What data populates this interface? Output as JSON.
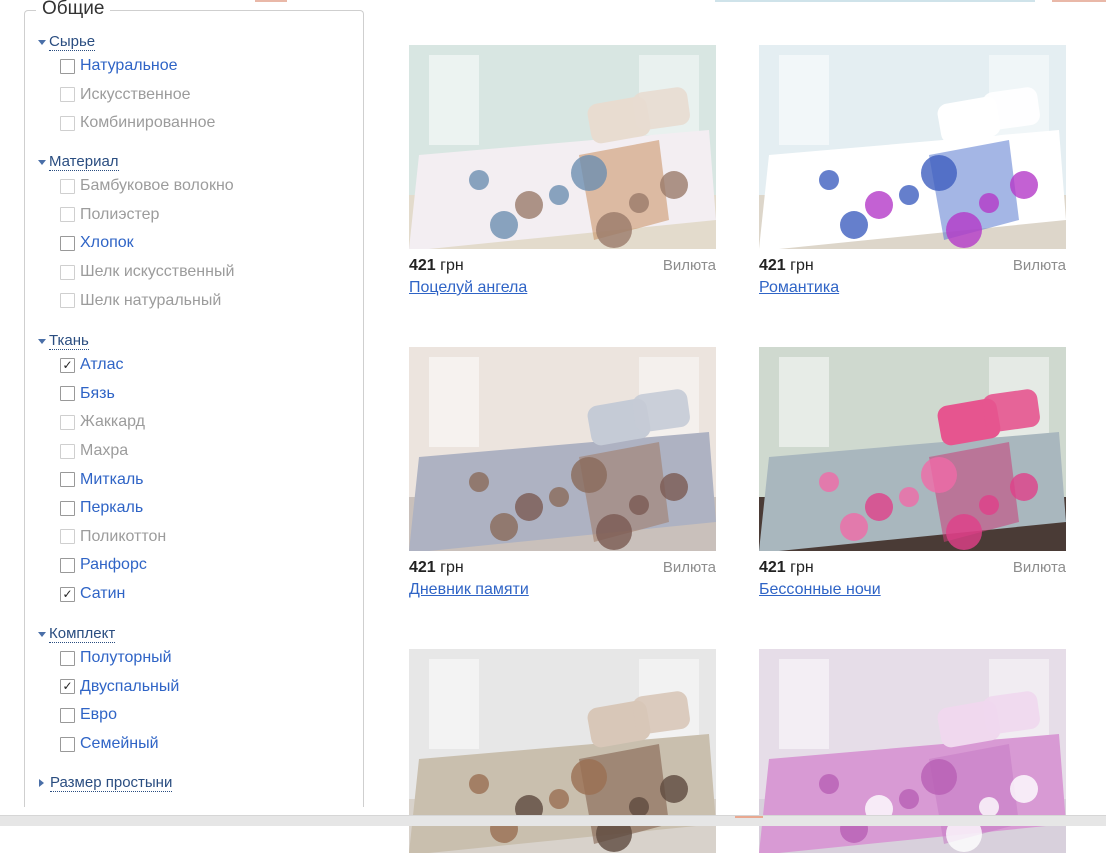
{
  "filters": {
    "title": "Общие",
    "groups": [
      {
        "label": "Сырье",
        "expanded": true,
        "options": [
          {
            "label": "Натуральное",
            "state": "active",
            "checked": false
          },
          {
            "label": "Искусственное",
            "state": "disabled",
            "checked": false
          },
          {
            "label": "Комбинированное",
            "state": "disabled",
            "checked": false
          }
        ]
      },
      {
        "label": "Материал",
        "expanded": true,
        "options": [
          {
            "label": "Бамбуковое волокно",
            "state": "disabled",
            "checked": false
          },
          {
            "label": "Полиэстер",
            "state": "disabled",
            "checked": false
          },
          {
            "label": "Хлопок",
            "state": "active",
            "checked": false
          },
          {
            "label": "Шелк искусственный",
            "state": "disabled",
            "checked": false
          },
          {
            "label": "Шелк натуральный",
            "state": "disabled",
            "checked": false
          }
        ]
      },
      {
        "label": "Ткань",
        "expanded": true,
        "options": [
          {
            "label": "Атлас",
            "state": "active",
            "checked": true
          },
          {
            "label": "Бязь",
            "state": "active",
            "checked": false
          },
          {
            "label": "Жаккард",
            "state": "disabled",
            "checked": false
          },
          {
            "label": "Махра",
            "state": "disabled",
            "checked": false
          },
          {
            "label": "Миткаль",
            "state": "active",
            "checked": false
          },
          {
            "label": "Перкаль",
            "state": "active",
            "checked": false
          },
          {
            "label": "Поликоттон",
            "state": "disabled",
            "checked": false
          },
          {
            "label": "Ранфорс",
            "state": "active",
            "checked": false
          },
          {
            "label": "Сатин",
            "state": "active",
            "checked": true
          }
        ]
      },
      {
        "label": "Комплект",
        "expanded": true,
        "options": [
          {
            "label": "Полуторный",
            "state": "active",
            "checked": false
          },
          {
            "label": "Двуспальный",
            "state": "active",
            "checked": true
          },
          {
            "label": "Евро",
            "state": "active",
            "checked": false
          },
          {
            "label": "Семейный",
            "state": "active",
            "checked": false
          }
        ]
      },
      {
        "label": "Размер простыни",
        "expanded": false,
        "options": []
      }
    ]
  },
  "products": [
    {
      "price": "421",
      "currency": "грн",
      "seller": "Вилюта",
      "name": "Поцелуй ангела",
      "image": "white bedding with brown-blue floral print"
    },
    {
      "price": "421",
      "currency": "грн",
      "seller": "Вилюта",
      "name": "Романтика",
      "image": "white and blue bedding with purple roses"
    },
    {
      "price": "421",
      "currency": "грн",
      "seller": "Вилюта",
      "name": "Дневник памяти",
      "image": "grey and brown paisley diagonal bedding"
    },
    {
      "price": "421",
      "currency": "грн",
      "seller": "Вилюта",
      "name": "Бессонные ночи",
      "image": "grey bedding with large pink roses"
    },
    {
      "price": "",
      "currency": "",
      "seller": "",
      "name": "",
      "image": "brown striped bedding with grey floral pillows"
    },
    {
      "price": "",
      "currency": "",
      "seller": "",
      "name": "",
      "image": "pink and beige bedding with white flowers"
    }
  ]
}
